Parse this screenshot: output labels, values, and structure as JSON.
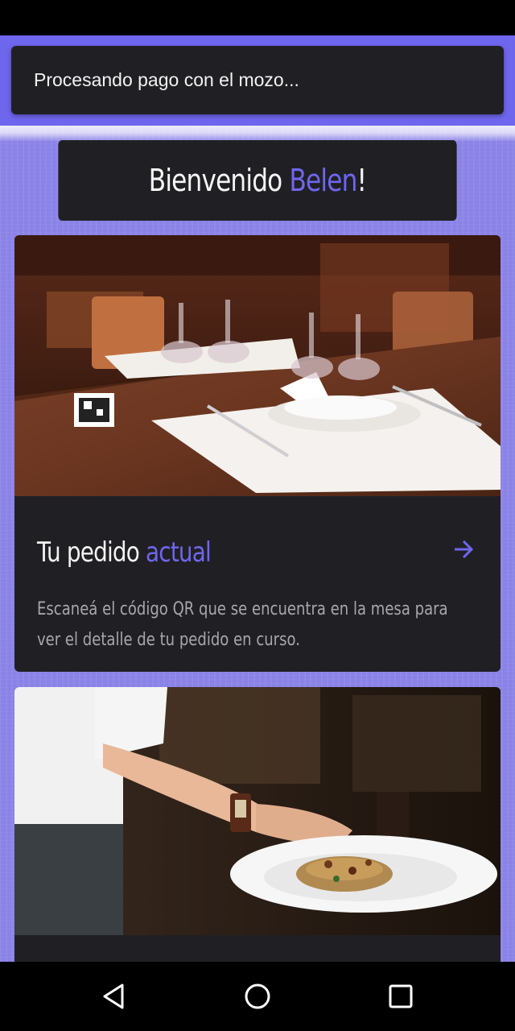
{
  "toast": {
    "message": "Procesando pago con el mozo..."
  },
  "welcome": {
    "prefix": "Bienvenido ",
    "name": "Belen",
    "suffix": "!"
  },
  "cards": [
    {
      "title_prefix": "Tu pedido ",
      "title_accent": "actual",
      "description": "Escaneá el código QR que se encuentra en la mesa para ver el detalle de tu pedido en curso.",
      "icon": "arrow-right-icon"
    },
    {
      "icon": "waiter-serving-image"
    }
  ],
  "colors": {
    "accent": "#6f66ee",
    "card_bg": "#202024",
    "background": "#8a82e6",
    "text_primary": "#f2f2f2",
    "text_secondary": "#a7a7ab"
  },
  "nav": {
    "back_icon": "back-triangle-icon",
    "home_icon": "home-circle-icon",
    "recents_icon": "recents-square-icon"
  }
}
